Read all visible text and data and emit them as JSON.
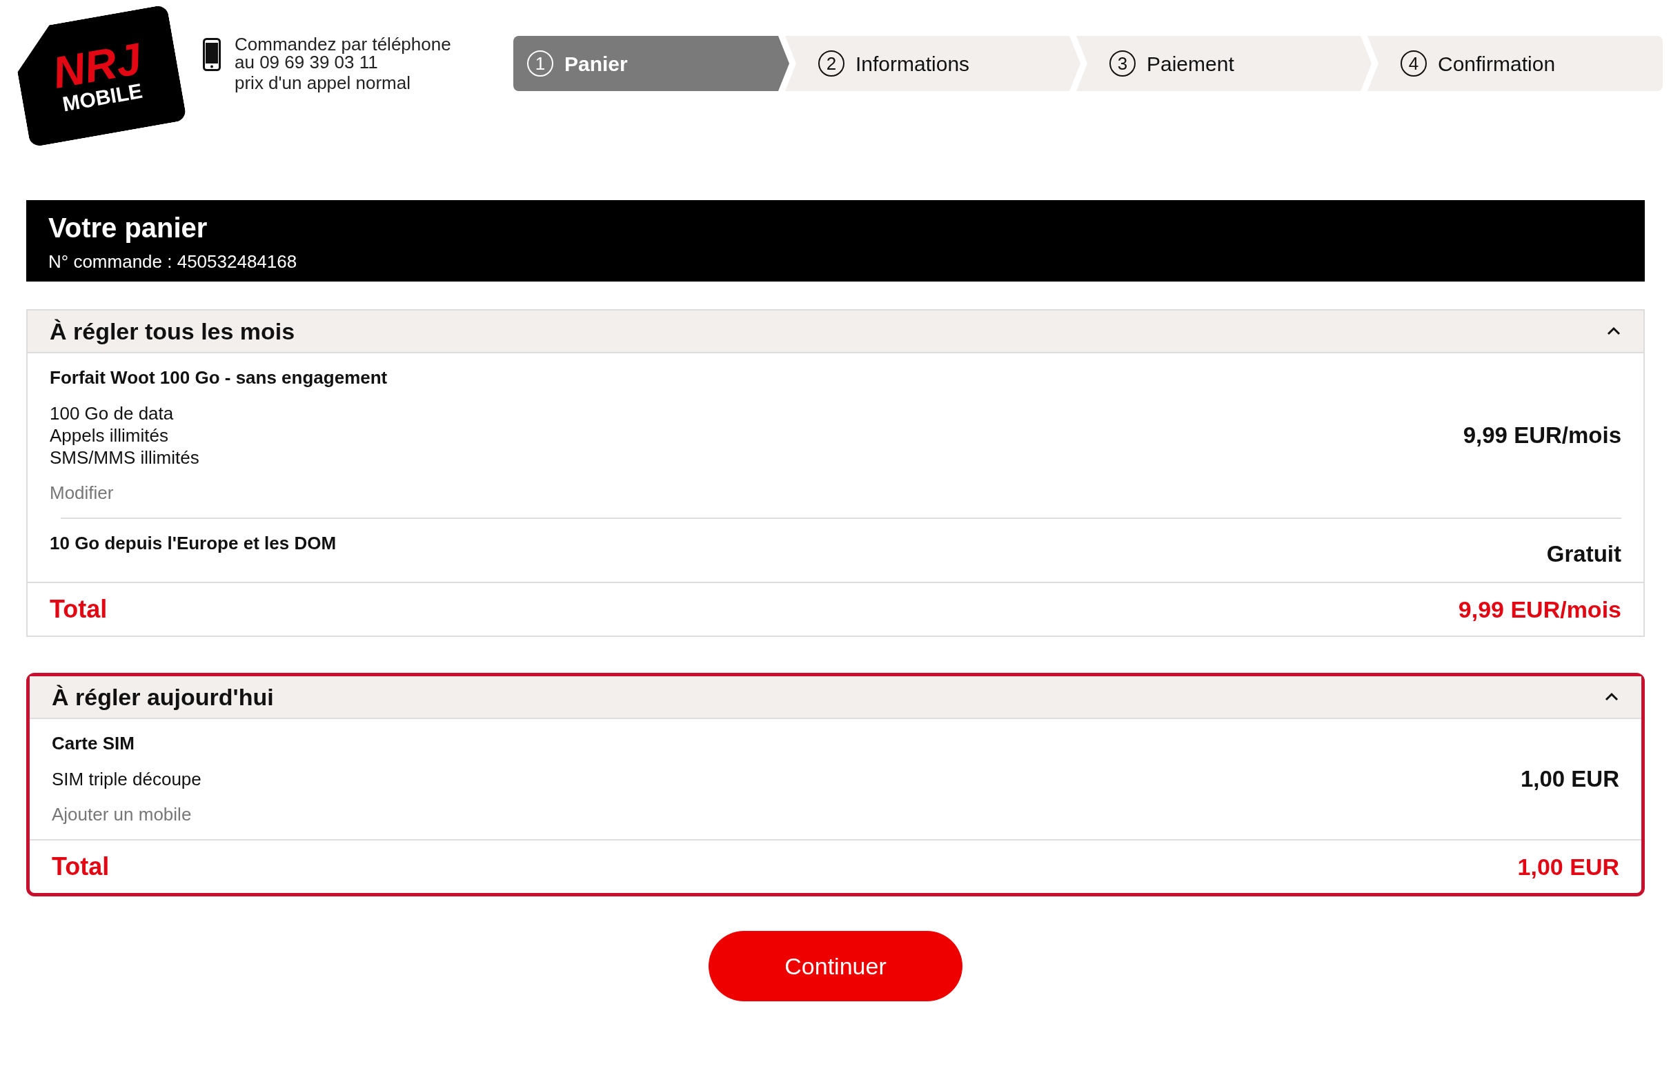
{
  "logo": {
    "brand": "NRJ",
    "sub": "MOBILE"
  },
  "phone": {
    "lines": [
      "Commandez par téléphone",
      "au 09 69 39 03 11"
    ],
    "note": "prix d'un appel normal"
  },
  "steps": [
    {
      "number": "1",
      "label": "Panier",
      "selected": true
    },
    {
      "number": "2",
      "label": "Informations",
      "selected": false
    },
    {
      "number": "3",
      "label": "Paiement",
      "selected": false
    },
    {
      "number": "4",
      "label": "Confirmation",
      "selected": false
    }
  ],
  "cart": {
    "title": "Votre panier",
    "order": "N° commande : 450532484168"
  },
  "sections": [
    {
      "title": "À régler tous les mois",
      "expanded": true,
      "highlighted": false,
      "items": [
        {
          "name": "Forfait Woot 100 Go - sans engagement",
          "features": [
            "100 Go de data",
            "Appels illimités",
            "SMS/MMS illimités"
          ],
          "link": "Modifier",
          "price": "9,99 EUR/mois"
        },
        {
          "name": "10 Go depuis l'Europe et les DOM",
          "price": "Gratuit"
        }
      ],
      "total_label": "Total",
      "total": "9,99 EUR/mois"
    },
    {
      "title": "À régler aujourd'hui",
      "expanded": true,
      "highlighted": true,
      "items": [
        {
          "name": "Carte SIM",
          "features": [
            "SIM triple découpe"
          ],
          "link": "Ajouter un mobile",
          "price": "1,00 EUR"
        }
      ],
      "total_label": "Total",
      "total": "1,00 EUR"
    }
  ],
  "continue_button": "Continuer"
}
